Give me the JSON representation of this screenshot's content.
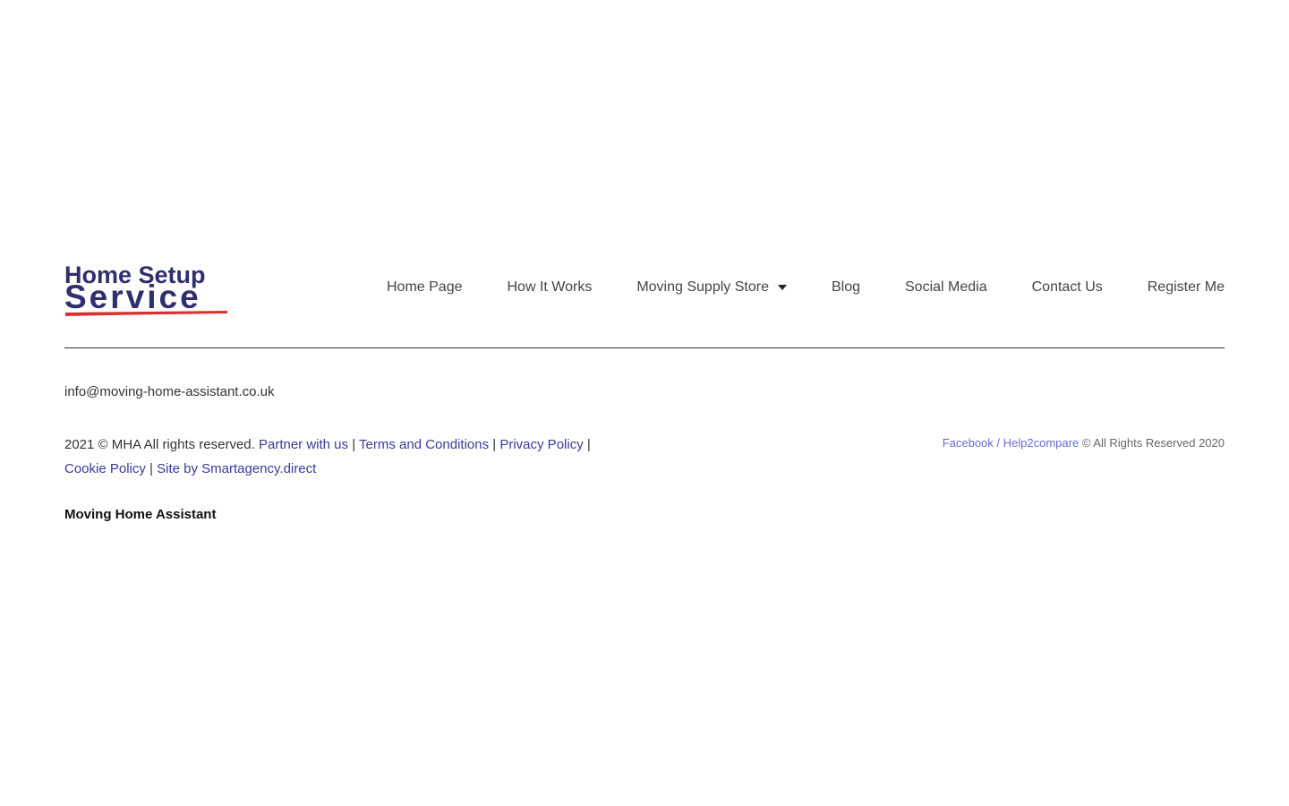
{
  "logo": {
    "line1": "Home Setup",
    "line2": "Service",
    "text_color": "#2f2f6e",
    "underline_color": "#d93030"
  },
  "nav": {
    "items": [
      {
        "label": "Home Page"
      },
      {
        "label": "How It Works"
      },
      {
        "label": "Moving Supply Store",
        "has_dropdown": true
      },
      {
        "label": "Blog"
      },
      {
        "label": "Social Media"
      },
      {
        "label": "Contact Us"
      },
      {
        "label": "Register Me"
      }
    ]
  },
  "footer": {
    "email": "info@moving-home-assistant.co.uk",
    "copyright": "2021 © MHA All rights reserved.",
    "links": {
      "partner": "Partner with us",
      "terms": "Terms and Conditions",
      "privacy": "Privacy Policy",
      "cookie": "Cookie Policy",
      "site_by": "Site by Smartagency.direct"
    },
    "separator": "|",
    "right": {
      "facebook": "Facebook",
      "slash": "/",
      "help2compare": "Help2compare",
      "rights": "© All Rights Reserved 2020"
    },
    "brand": "Moving Home Assistant"
  },
  "colors": {
    "link": "#3a3a9a",
    "link_light": "#6a6acc",
    "text": "#333333"
  }
}
